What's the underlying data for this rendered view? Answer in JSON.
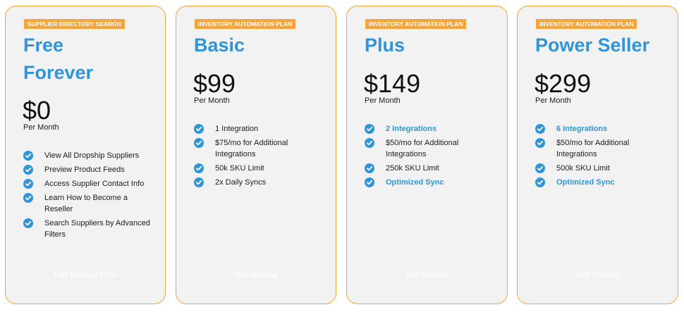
{
  "colors": {
    "accent": "#2f95d8",
    "badge": "#f7a43b",
    "card_bg": "#f2f2f2"
  },
  "plans": [
    {
      "badge": "SUPPLIER DIRECTORY SEARCH",
      "name_line1": "Free",
      "name_line2": "Forever",
      "price": "$0",
      "period": "Per Month",
      "features": [
        {
          "text": "View All Dropship Suppliers",
          "highlight": false
        },
        {
          "text": "Preview Product Feeds",
          "highlight": false
        },
        {
          "text": "Access Supplier Contact Info",
          "highlight": false
        },
        {
          "text": "Learn How to Become a Reseller",
          "highlight": false
        },
        {
          "text": "Search Suppliers by Advanced Filters",
          "highlight": false
        }
      ],
      "cta": "Get Started Free"
    },
    {
      "badge": "INVENTORY AUTOMATION PLAN",
      "name": "Basic",
      "price": "$99",
      "period": "Per Month",
      "features": [
        {
          "text": "1 Integration",
          "highlight": false
        },
        {
          "text": "$75/mo for Additional Integrations",
          "highlight": false
        },
        {
          "text": "50k SKU Limit",
          "highlight": false
        },
        {
          "text": "2x Daily Syncs",
          "highlight": false
        }
      ],
      "cta": "Get Started"
    },
    {
      "badge": "INVENTORY AUTOMATION PLAN",
      "name": "Plus",
      "price": "$149",
      "period": "Per Month",
      "features": [
        {
          "text": "2 Integrations",
          "highlight": true
        },
        {
          "text": "$50/mo for Additional Integrations",
          "highlight": false
        },
        {
          "text": "250k SKU Limit",
          "highlight": false
        },
        {
          "text": "Optimized Sync",
          "highlight": true
        }
      ],
      "cta": "Get Started"
    },
    {
      "badge": "INVENTORY AUTOMATION PLAN",
      "name": "Power Seller",
      "price": "$299",
      "period": "Per Month",
      "features": [
        {
          "text": "6 Integrations",
          "highlight": true
        },
        {
          "text": "$50/mo for Additional Integrations",
          "highlight": false
        },
        {
          "text": "500k SKU Limit",
          "highlight": false
        },
        {
          "text": "Optimized Sync",
          "highlight": true
        }
      ],
      "cta": "Get Started"
    }
  ]
}
